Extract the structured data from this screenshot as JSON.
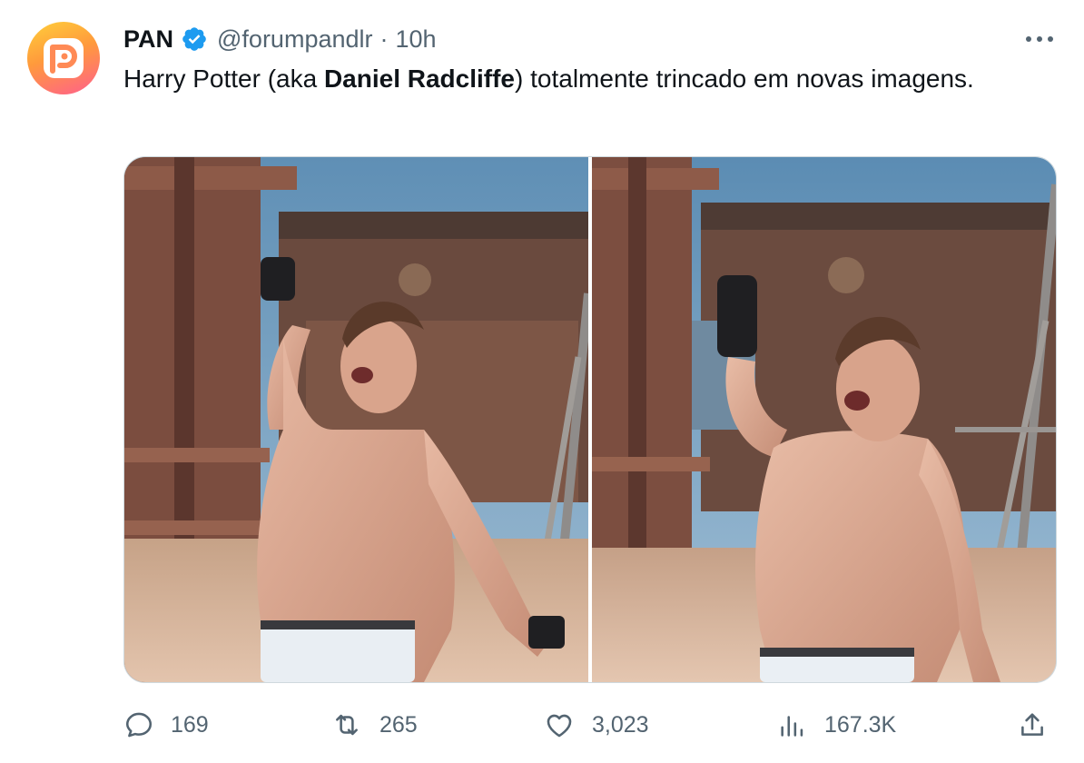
{
  "tweet": {
    "author": {
      "display_name": "PAN",
      "verified": true,
      "handle": "@forumpandlr",
      "separator": "·",
      "time": "10h",
      "avatar_icon": "pan-logo-icon"
    },
    "text": {
      "part1": "Harry Potter (aka ",
      "bold": "Daniel Radcliffe",
      "part2": ") totalmente trincado em novas imagens."
    },
    "media": {
      "count": 2
    },
    "actions": {
      "replies": "169",
      "retweets": "265",
      "likes": "3,023",
      "views": "167.3K"
    }
  },
  "colors": {
    "text_primary": "#0f1419",
    "text_secondary": "#536471",
    "verified_blue": "#1d9bf0",
    "border": "#cfd9de"
  },
  "icons": [
    "pan-logo-icon",
    "verified-badge-icon",
    "more-options-icon",
    "reply-icon",
    "retweet-icon",
    "like-icon",
    "views-icon",
    "share-icon"
  ]
}
